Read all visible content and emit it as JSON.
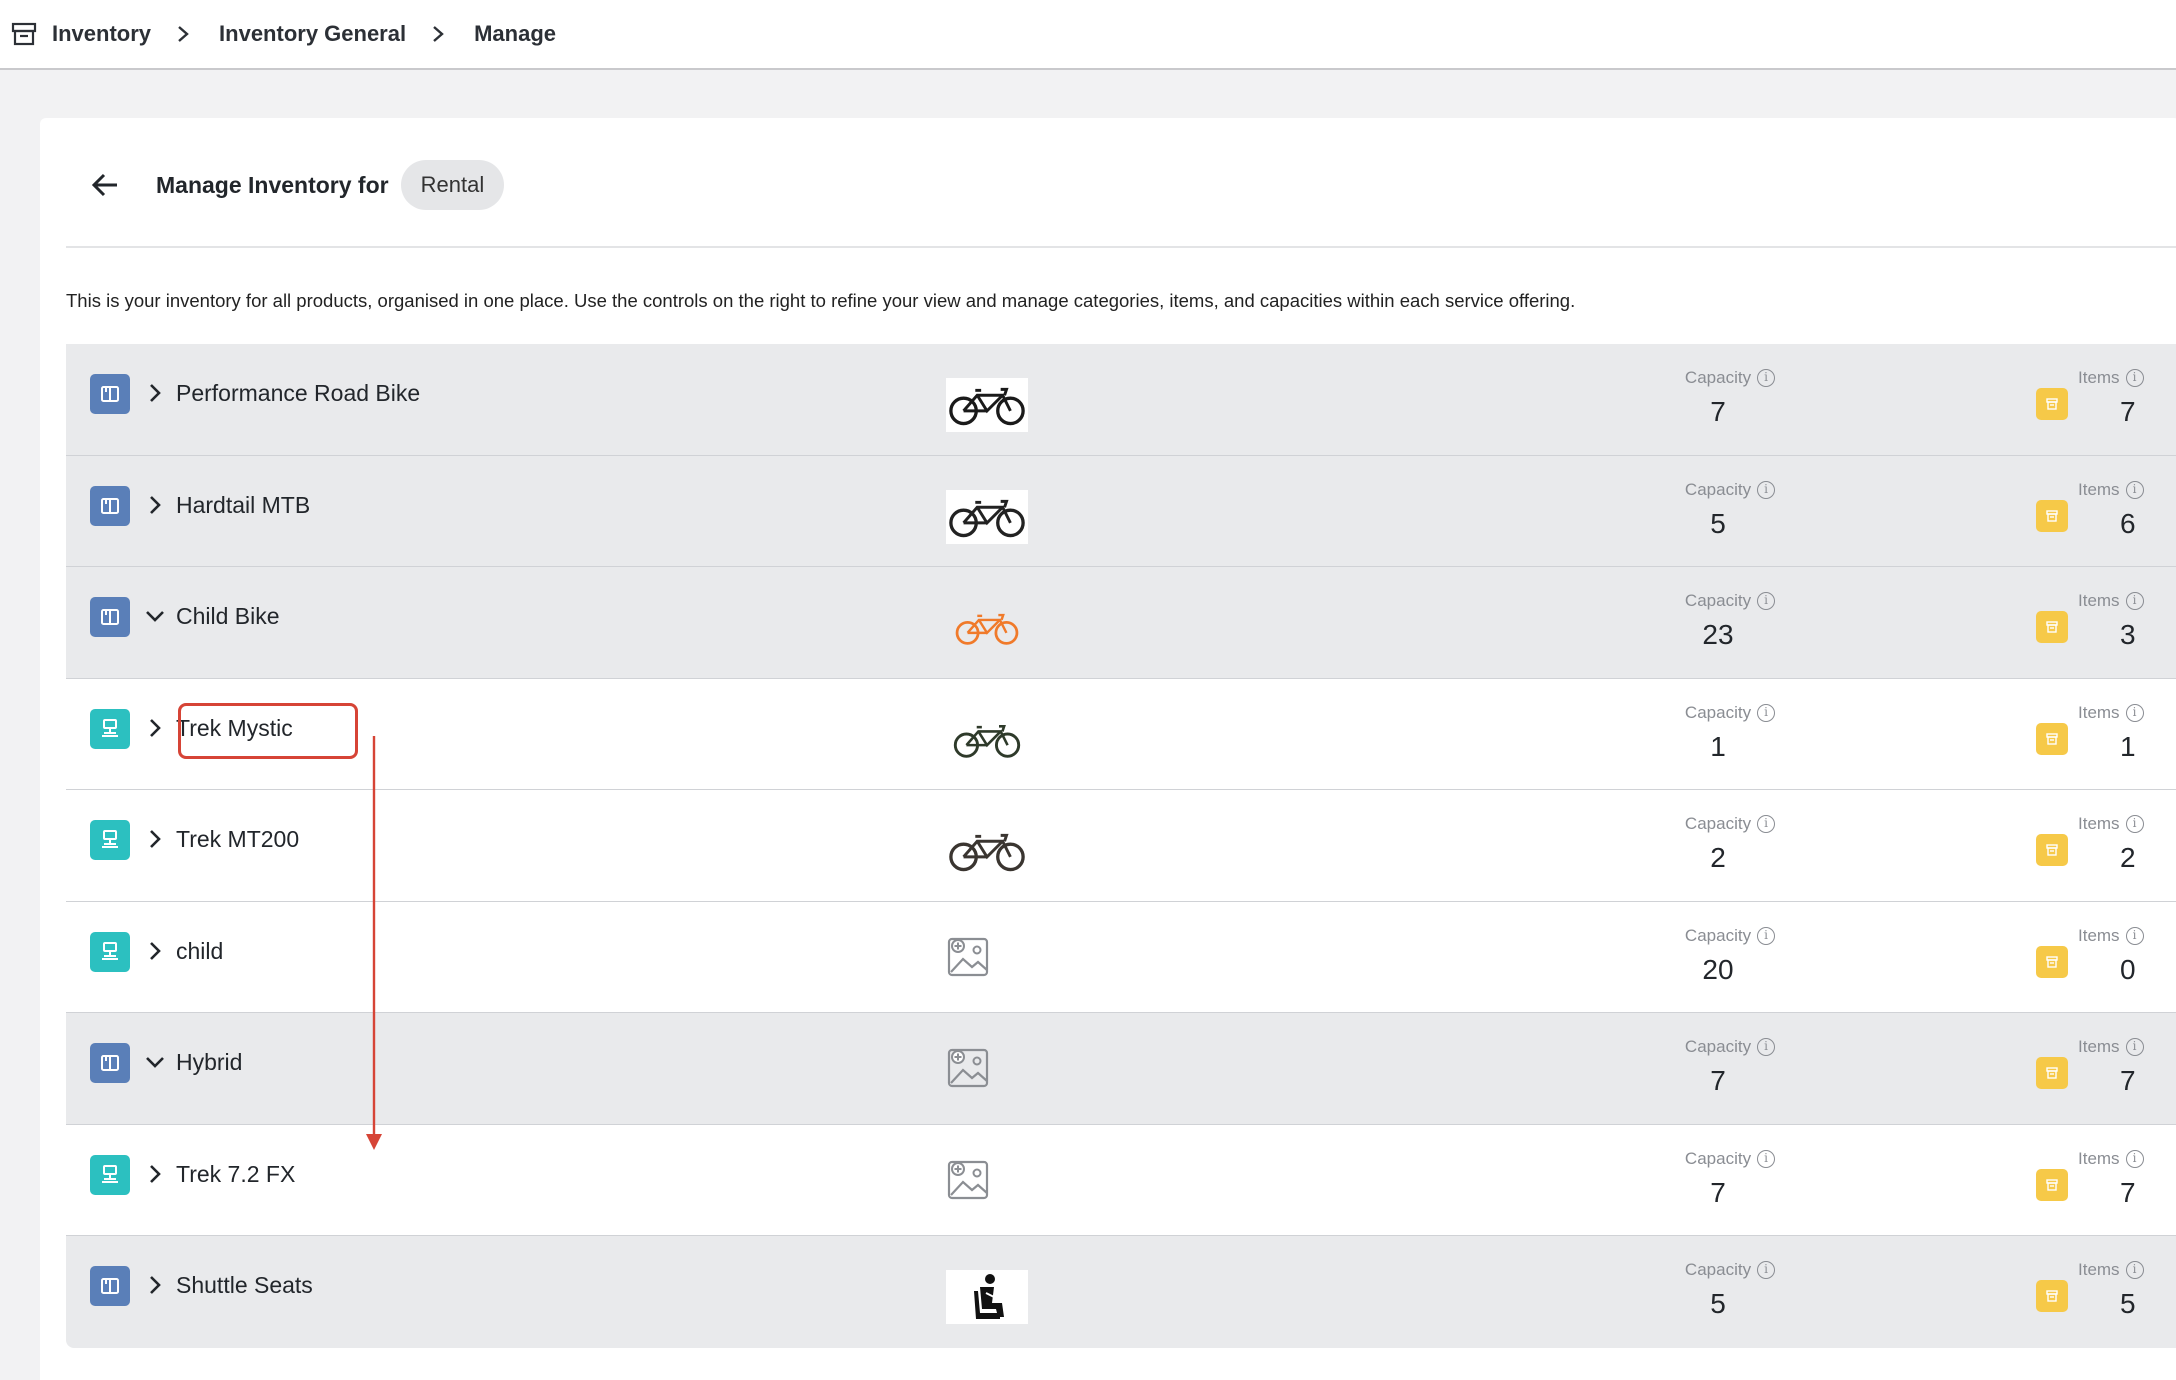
{
  "breadcrumb": {
    "icon": "archive-box-icon",
    "items": [
      "Inventory",
      "Inventory General",
      "Manage"
    ]
  },
  "header": {
    "title": "Manage Inventory for",
    "chip": "Rental"
  },
  "description": "This is your inventory for all products, organised in one place. Use the controls on the right to refine your view and manage categories, items, and capacities within each service offering.",
  "labels": {
    "capacity": "Capacity",
    "items": "Items"
  },
  "colors": {
    "category_icon": "#5a7fb8",
    "item_icon": "#2cc0c0",
    "items_badge": "#f6c948",
    "highlight": "#d64436"
  },
  "rows": [
    {
      "kind": "category",
      "name": "Performance Road Bike",
      "expanded": false,
      "image": "road-bike-photo",
      "capacity": "7",
      "items": "7"
    },
    {
      "kind": "category",
      "name": "Hardtail MTB",
      "expanded": false,
      "image": "mtb-photo",
      "capacity": "5",
      "items": "6"
    },
    {
      "kind": "category",
      "name": "Child Bike",
      "expanded": true,
      "image": "orange-bike-icon",
      "capacity": "23",
      "items": "3"
    },
    {
      "kind": "item",
      "name": "Trek Mystic",
      "expanded": false,
      "image": "small-bike-photo",
      "capacity": "1",
      "items": "1",
      "highlighted": true
    },
    {
      "kind": "item",
      "name": "Trek MT200",
      "expanded": false,
      "image": "city-bike-photo",
      "capacity": "2",
      "items": "2"
    },
    {
      "kind": "item",
      "name": "child",
      "expanded": false,
      "image": "image-placeholder-icon",
      "capacity": "20",
      "items": "0"
    },
    {
      "kind": "category",
      "name": "Hybrid",
      "expanded": true,
      "image": "image-placeholder-icon",
      "capacity": "7",
      "items": "7"
    },
    {
      "kind": "item",
      "name": "Trek 7.2 FX",
      "expanded": false,
      "image": "image-placeholder-icon",
      "capacity": "7",
      "items": "7"
    },
    {
      "kind": "category",
      "name": "Shuttle Seats",
      "expanded": false,
      "image": "seat-icon",
      "capacity": "5",
      "items": "5"
    }
  ]
}
